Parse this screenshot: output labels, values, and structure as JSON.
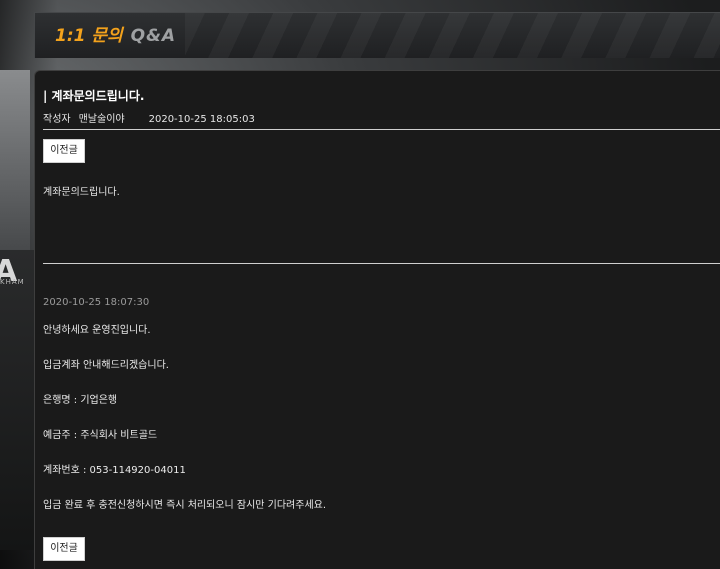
{
  "header": {
    "title_main": "1:1 문의",
    "title_sub": "Q&A"
  },
  "background": {
    "sign_letter": "A",
    "sign_sub": "KHAM"
  },
  "post": {
    "title": "| 계좌문의드립니다.",
    "author_label": "작성자",
    "author_name": "맨날술이야",
    "datetime": "2020-10-25 18:05:03",
    "prev_button_label": "이전글",
    "body": "계좌문의드립니다."
  },
  "reply": {
    "datetime": "2020-10-25 18:07:30",
    "lines": [
      "안녕하세요 운영진입니다.",
      "입금계좌 안내해드리겠습니다.",
      "은행명 : 기업은행",
      "예금주 : 주식회사 비트골드",
      "계좌번호 : 053-114920-04011",
      "입금 완료 후 충전신청하시면 즉시 처리되오니 잠시만 기다려주세요."
    ]
  },
  "footer": {
    "prev_button_label": "이전글"
  },
  "colors": {
    "accent": "#f3a21c",
    "panel": "#1a1a1a"
  }
}
